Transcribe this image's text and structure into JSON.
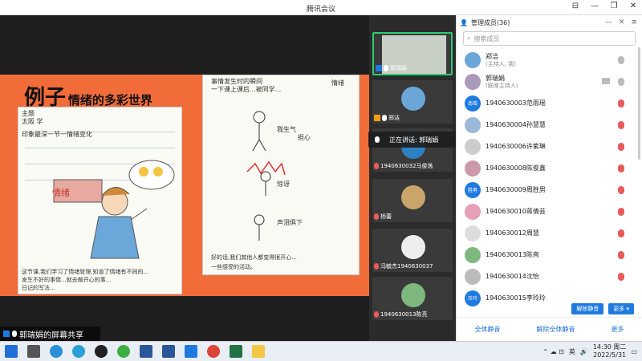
{
  "window": {
    "title": "腾讯会议"
  },
  "slide": {
    "title_big": "例子",
    "title_small": "情绪的多彩世界",
    "left_texts": [
      "主题",
      "太阪 学",
      "印象最深一节一情绪变化",
      "情绪",
      "这节课,我们学习了情绪管理,知道了情绪有不同的...",
      "发生不好的事情...就去做开心的事...",
      "日记的写法..."
    ],
    "right_texts": [
      "事情发生时的瞬间",
      "一下课上课后...被同学...",
      "情绪",
      "我生气",
      "担心",
      "惊讶",
      "声泪俱下",
      "好的话,我们其他人都变得很开心...",
      "一些感受的活动。"
    ]
  },
  "share_label": "郭瑞娟的屏幕共享",
  "speaking": "正在讲话: 郭瑞娟",
  "video_tiles": [
    {
      "name": "郭瑞娟",
      "active": true
    },
    {
      "name": "郑洁"
    },
    {
      "name": "1940630032马俊逸"
    },
    {
      "name": "杨蕾"
    },
    {
      "name": "冯毓杰1940630037"
    },
    {
      "name": "1940630013陈亮"
    }
  ],
  "panel": {
    "title": "管理成员(36)",
    "search_placeholder": "搜索成员",
    "members": [
      {
        "name": "郑洁",
        "sub": "(主持人, 我)",
        "mute": false
      },
      {
        "name": "郭瑞娟",
        "sub": "(联席主持人)",
        "mute": false
      },
      {
        "name": "1940630003范雨瑶",
        "avatar": "南瑶",
        "mute": true
      },
      {
        "name": "1940630004孙慧慧",
        "mute": true
      },
      {
        "name": "1940630006许紫琳",
        "mute": true
      },
      {
        "name": "1940630008陈俊鑫",
        "mute": true
      },
      {
        "name": "1940630009周胜男",
        "avatar": "胜男",
        "mute": true
      },
      {
        "name": "1940630010蒋倩芸",
        "mute": true
      },
      {
        "name": "1940630012周慧",
        "mute": true
      },
      {
        "name": "1940630013陈亮",
        "mute": true
      },
      {
        "name": "1940630014沈怡",
        "mute": true
      },
      {
        "name": "1940630015李玲玲",
        "avatar": "玲玲",
        "mute": true
      }
    ],
    "unmute_all_btn": "解除静音",
    "more_btn": "更多 ▾",
    "footer": [
      "全体静音",
      "解除全体静音",
      "更多"
    ]
  },
  "taskbar": {
    "time": "14:30 周二",
    "date": "2022/5/31",
    "ime": "英"
  }
}
